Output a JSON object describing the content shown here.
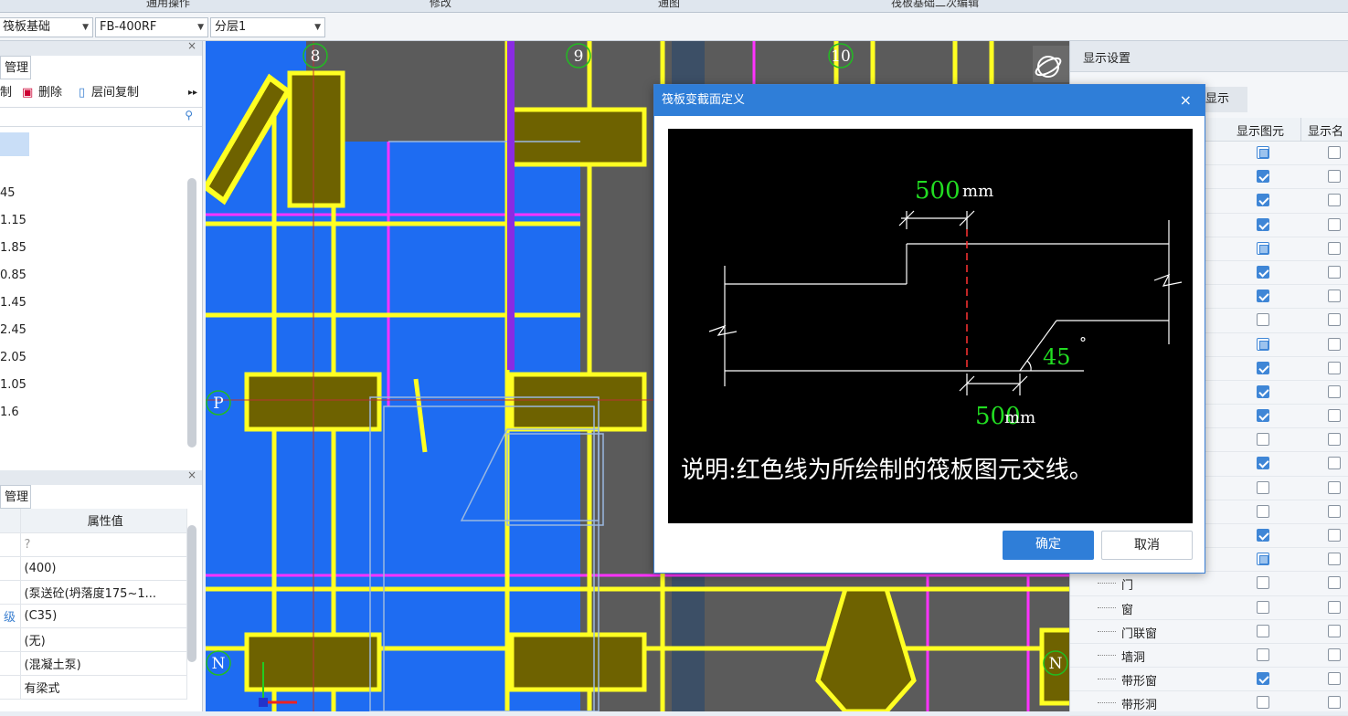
{
  "top_strip": {
    "items": [
      "通用操作",
      "修改",
      "通图",
      "筏板基础二次编辑"
    ]
  },
  "toolbar": {
    "combo1": "筏板基础",
    "combo2": "FB-400RF",
    "combo3": "分层1"
  },
  "left_top": {
    "title": "管理",
    "tools": [
      "制",
      "删除",
      "层间复制"
    ],
    "values": [
      "45",
      "1.15",
      "1.85",
      "0.85",
      "1.45",
      "2.45",
      "2.05",
      "1.05",
      "1.6"
    ]
  },
  "left_bottom": {
    "title": "管理",
    "header": "属性值",
    "rows": [
      {
        "label": "",
        "value": "?"
      },
      {
        "label": "",
        "value": "(400)"
      },
      {
        "label": "",
        "value": "(泵送砼(坍落度175~1..."
      },
      {
        "label": "级",
        "value": "(C35)"
      },
      {
        "label": "",
        "value": "(无)"
      },
      {
        "label": "",
        "value": "(混凝土泵)"
      },
      {
        "label": "",
        "value": "有梁式"
      }
    ]
  },
  "cad": {
    "axis_labels": [
      "8",
      "9",
      "10",
      "P",
      "N",
      "N"
    ],
    "axis_colors": {
      "background": "#5b5b5b",
      "slab": "#1e6cf2",
      "beam": "#ffff22",
      "axis": "#ff33ff"
    }
  },
  "right_panel": {
    "title": "显示设置",
    "tab": "显示",
    "col_element": "显示图元",
    "col_name": "显示名",
    "rows": [
      {
        "label": "",
        "state": "part",
        "name": false
      },
      {
        "label": "",
        "state": "on",
        "name": false
      },
      {
        "label": "",
        "state": "on",
        "name": false
      },
      {
        "label": "",
        "state": "on",
        "name": false
      },
      {
        "label": "",
        "state": "part",
        "name": false
      },
      {
        "label": "",
        "state": "on",
        "name": false
      },
      {
        "label": "",
        "state": "on",
        "name": false
      },
      {
        "label": "",
        "state": "off",
        "name": false
      },
      {
        "label": "",
        "state": "part",
        "name": false
      },
      {
        "label": "",
        "state": "on",
        "name": false
      },
      {
        "label": "",
        "state": "on",
        "name": false
      },
      {
        "label": "",
        "state": "on",
        "name": false
      },
      {
        "label": "",
        "state": "off",
        "name": false
      },
      {
        "label": "",
        "state": "on",
        "name": false
      },
      {
        "label": "",
        "state": "off",
        "name": false
      },
      {
        "label": "",
        "state": "off",
        "name": false
      },
      {
        "label": "",
        "state": "on",
        "name": false
      },
      {
        "label": "",
        "state": "part",
        "name": false
      },
      {
        "label": "门",
        "state": "off",
        "name": false
      },
      {
        "label": "窗",
        "state": "off",
        "name": false
      },
      {
        "label": "门联窗",
        "state": "off",
        "name": false
      },
      {
        "label": "墙洞",
        "state": "off",
        "name": false
      },
      {
        "label": "带形窗",
        "state": "on",
        "name": false
      },
      {
        "label": "带形洞",
        "state": "off",
        "name": false
      }
    ]
  },
  "dialog": {
    "title": "筏板变截面定义",
    "dim_top_value": "500",
    "dim_top_unit": "mm",
    "angle_value": "45",
    "angle_unit": "°",
    "dim_bottom_value": "500",
    "dim_bottom_unit": "mm",
    "note": "说明:红色线为所绘制的筏板图元交线。",
    "ok": "确定",
    "cancel": "取消"
  }
}
